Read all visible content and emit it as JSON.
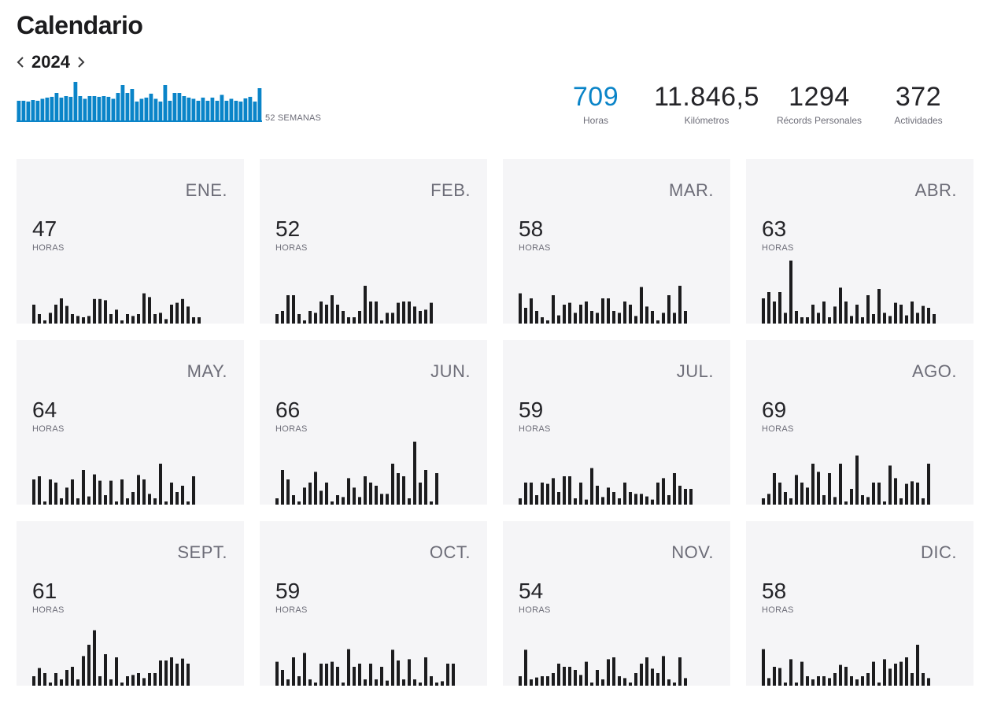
{
  "header": {
    "title": "Calendario"
  },
  "year_nav": {
    "year": "2024",
    "prev_icon": "chevron-left-icon",
    "next_icon": "chevron-right-icon"
  },
  "weekly_overview": {
    "label": "52 SEMANAS",
    "color": "#0a84c8",
    "values": [
      0.5,
      0.5,
      0.48,
      0.52,
      0.5,
      0.55,
      0.58,
      0.6,
      0.7,
      0.58,
      0.62,
      0.6,
      0.98,
      0.62,
      0.55,
      0.62,
      0.62,
      0.6,
      0.62,
      0.6,
      0.55,
      0.7,
      0.9,
      0.7,
      0.8,
      0.48,
      0.55,
      0.58,
      0.68,
      0.55,
      0.48,
      0.9,
      0.5,
      0.7,
      0.7,
      0.62,
      0.58,
      0.55,
      0.5,
      0.58,
      0.5,
      0.58,
      0.5,
      0.65,
      0.5,
      0.55,
      0.5,
      0.48,
      0.56,
      0.6,
      0.48,
      0.82
    ]
  },
  "stats": [
    {
      "value": "709",
      "label": "Horas"
    },
    {
      "value": "11.846,5",
      "label": "Kilómetros"
    },
    {
      "value": "1294",
      "label": "Récords Personales"
    },
    {
      "value": "372",
      "label": "Actividades"
    }
  ],
  "colors": {
    "accent": "#0a84c8",
    "bar": "#1c1c1e",
    "card": "#f5f5f7"
  },
  "months": [
    {
      "name": "ENE.",
      "hours": "47",
      "unit": "HORAS",
      "bars": [
        0.3,
        0.15,
        0.05,
        0.17,
        0.3,
        0.4,
        0.28,
        0.15,
        0.12,
        0.1,
        0.12,
        0.39,
        0.39,
        0.37,
        0.15,
        0.22,
        0.05,
        0.15,
        0.12,
        0.15,
        0.48,
        0.42,
        0.15,
        0.17,
        0.07,
        0.3,
        0.33,
        0.39,
        0.27,
        0.1,
        0.1
      ]
    },
    {
      "name": "FEB.",
      "hours": "52",
      "unit": "HORAS",
      "bars": [
        0.15,
        0.2,
        0.45,
        0.45,
        0.15,
        0.05,
        0.2,
        0.17,
        0.35,
        0.3,
        0.45,
        0.3,
        0.2,
        0.1,
        0.1,
        0.2,
        0.6,
        0.35,
        0.35,
        0.05,
        0.17,
        0.17,
        0.33,
        0.35,
        0.35,
        0.27,
        0.2,
        0.22,
        0.33
      ]
    },
    {
      "name": "MAR.",
      "hours": "58",
      "unit": "HORAS",
      "bars": [
        0.48,
        0.25,
        0.4,
        0.2,
        0.1,
        0.05,
        0.45,
        0.13,
        0.3,
        0.33,
        0.17,
        0.3,
        0.35,
        0.2,
        0.17,
        0.4,
        0.4,
        0.2,
        0.17,
        0.35,
        0.3,
        0.12,
        0.58,
        0.27,
        0.2,
        0.05,
        0.17,
        0.45,
        0.17,
        0.6,
        0.2
      ]
    },
    {
      "name": "ABR.",
      "hours": "63",
      "unit": "HORAS",
      "bars": [
        0.4,
        0.5,
        0.35,
        0.5,
        0.17,
        1.0,
        0.2,
        0.1,
        0.1,
        0.3,
        0.17,
        0.35,
        0.1,
        0.27,
        0.57,
        0.35,
        0.12,
        0.3,
        0.1,
        0.45,
        0.15,
        0.55,
        0.17,
        0.12,
        0.33,
        0.3,
        0.13,
        0.35,
        0.17,
        0.28,
        0.25,
        0.15
      ]
    },
    {
      "name": "MAY.",
      "hours": "64",
      "unit": "HORAS",
      "bars": [
        0.4,
        0.45,
        0.05,
        0.4,
        0.35,
        0.1,
        0.27,
        0.4,
        0.1,
        0.55,
        0.13,
        0.48,
        0.38,
        0.15,
        0.38,
        0.05,
        0.4,
        0.1,
        0.2,
        0.47,
        0.4,
        0.17,
        0.1,
        0.65,
        0.05,
        0.35,
        0.2,
        0.3,
        0.05,
        0.45
      ]
    },
    {
      "name": "JUN.",
      "hours": "66",
      "unit": "HORAS",
      "bars": [
        0.1,
        0.55,
        0.4,
        0.15,
        0.05,
        0.27,
        0.35,
        0.52,
        0.22,
        0.35,
        0.05,
        0.15,
        0.12,
        0.42,
        0.27,
        0.12,
        0.45,
        0.35,
        0.3,
        0.17,
        0.17,
        0.65,
        0.5,
        0.45,
        0.1,
        1.0,
        0.35,
        0.55,
        0.05,
        0.5
      ]
    },
    {
      "name": "JUL.",
      "hours": "59",
      "unit": "HORAS",
      "bars": [
        0.1,
        0.35,
        0.35,
        0.15,
        0.35,
        0.33,
        0.42,
        0.2,
        0.45,
        0.45,
        0.1,
        0.35,
        0.08,
        0.58,
        0.3,
        0.12,
        0.27,
        0.2,
        0.1,
        0.35,
        0.2,
        0.17,
        0.17,
        0.13,
        0.08,
        0.35,
        0.42,
        0.15,
        0.5,
        0.3,
        0.25,
        0.25
      ]
    },
    {
      "name": "AGO.",
      "hours": "69",
      "unit": "HORAS",
      "bars": [
        0.1,
        0.17,
        0.5,
        0.35,
        0.2,
        0.1,
        0.47,
        0.35,
        0.27,
        0.65,
        0.52,
        0.15,
        0.5,
        0.12,
        0.65,
        0.05,
        0.25,
        0.78,
        0.15,
        0.12,
        0.35,
        0.35,
        0.05,
        0.62,
        0.42,
        0.1,
        0.33,
        0.37,
        0.35,
        0.1,
        0.65
      ]
    },
    {
      "name": "SEPT.",
      "hours": "61",
      "unit": "HORAS",
      "bars": [
        0.15,
        0.28,
        0.2,
        0.05,
        0.2,
        0.1,
        0.25,
        0.3,
        0.1,
        0.47,
        0.65,
        0.88,
        0.15,
        0.5,
        0.1,
        0.45,
        0.05,
        0.15,
        0.17,
        0.2,
        0.12,
        0.2,
        0.2,
        0.4,
        0.4,
        0.45,
        0.35,
        0.43,
        0.35
      ]
    },
    {
      "name": "OCT.",
      "hours": "59",
      "unit": "HORAS",
      "bars": [
        0.38,
        0.25,
        0.1,
        0.45,
        0.15,
        0.52,
        0.1,
        0.05,
        0.35,
        0.35,
        0.38,
        0.3,
        0.05,
        0.58,
        0.3,
        0.35,
        0.1,
        0.35,
        0.1,
        0.3,
        0.08,
        0.57,
        0.4,
        0.1,
        0.42,
        0.1,
        0.05,
        0.45,
        0.15,
        0.05,
        0.07,
        0.35,
        0.35
      ]
    },
    {
      "name": "NOV.",
      "hours": "54",
      "unit": "HORAS",
      "bars": [
        0.15,
        0.57,
        0.1,
        0.13,
        0.15,
        0.15,
        0.2,
        0.35,
        0.3,
        0.3,
        0.25,
        0.17,
        0.38,
        0.05,
        0.25,
        0.1,
        0.42,
        0.45,
        0.15,
        0.12,
        0.05,
        0.2,
        0.35,
        0.45,
        0.27,
        0.2,
        0.47,
        0.1,
        0.05,
        0.45,
        0.12
      ]
    },
    {
      "name": "DIC.",
      "hours": "58",
      "unit": "HORAS",
      "bars": [
        0.58,
        0.12,
        0.3,
        0.28,
        0.05,
        0.42,
        0.05,
        0.38,
        0.15,
        0.1,
        0.15,
        0.15,
        0.12,
        0.2,
        0.33,
        0.3,
        0.15,
        0.1,
        0.15,
        0.2,
        0.38,
        0.05,
        0.42,
        0.27,
        0.35,
        0.38,
        0.45,
        0.2,
        0.65,
        0.2,
        0.12
      ]
    }
  ]
}
